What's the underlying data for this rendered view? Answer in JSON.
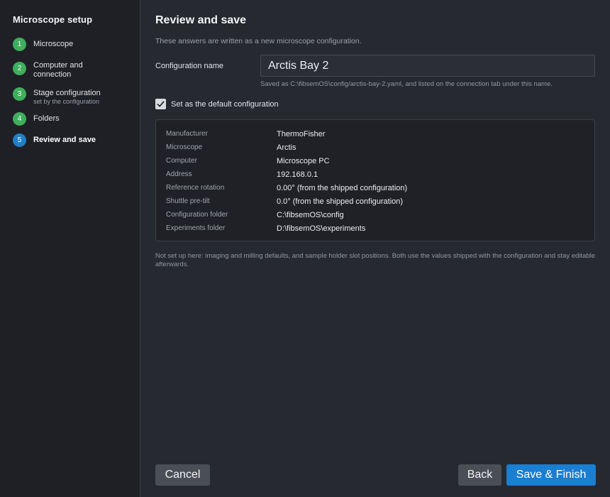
{
  "sidebar": {
    "title": "Microscope setup",
    "steps": [
      {
        "number": "1",
        "label": "Microscope",
        "sub": ""
      },
      {
        "number": "2",
        "label": "Computer and connection",
        "sub": ""
      },
      {
        "number": "3",
        "label": "Stage configuration",
        "sub": "set by the configuration"
      },
      {
        "number": "4",
        "label": "Folders",
        "sub": ""
      },
      {
        "number": "5",
        "label": "Review and save",
        "sub": ""
      }
    ]
  },
  "main": {
    "title": "Review and save",
    "description": "These answers are written as a new microscope configuration.",
    "config_name": {
      "label": "Configuration name",
      "value": "Arctis Bay 2",
      "help": "Saved as C:\\fibsemOS\\config/arctis-bay-2.yaml, and listed on the connection tab under this name."
    },
    "default_checkbox": {
      "label": "Set as the default configuration",
      "checked": true
    },
    "summary": [
      {
        "key": "Manufacturer",
        "value": "ThermoFisher"
      },
      {
        "key": "Microscope",
        "value": "Arctis"
      },
      {
        "key": "Computer",
        "value": "Microscope PC"
      },
      {
        "key": "Address",
        "value": "192.168.0.1"
      },
      {
        "key": "Reference rotation",
        "value": "0.00° (from the shipped configuration)"
      },
      {
        "key": "Shuttle pre-tilt",
        "value": "0.0° (from the shipped configuration)"
      },
      {
        "key": "Configuration folder",
        "value": "C:\\fibsemOS\\config"
      },
      {
        "key": "Experiments folder",
        "value": "D:\\fibsemOS\\experiments"
      }
    ],
    "footnote": "Not set up here: imaging and milling defaults, and sample holder slot positions. Both use the values shipped with the configuration and stay editable afterwards."
  },
  "footer": {
    "cancel_label": "Cancel",
    "back_label": "Back",
    "finish_label": "Save & Finish"
  },
  "colors": {
    "done_step": "#3fae5d",
    "active_step": "#1f80c6",
    "primary_button": "#1a7ed1"
  }
}
